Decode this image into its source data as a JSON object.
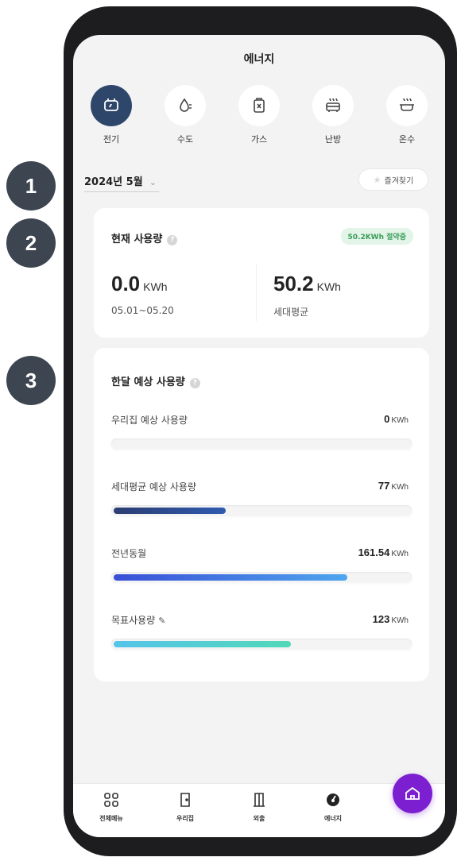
{
  "header": {
    "title": "에너지"
  },
  "categories": [
    {
      "label": "전기",
      "icon": "plug-icon",
      "active": true
    },
    {
      "label": "수도",
      "icon": "water-drop-icon",
      "active": false
    },
    {
      "label": "가스",
      "icon": "gas-can-icon",
      "active": false
    },
    {
      "label": "난방",
      "icon": "radiator-icon",
      "active": false
    },
    {
      "label": "온수",
      "icon": "hot-water-icon",
      "active": false
    }
  ],
  "markers": [
    "1",
    "2",
    "3"
  ],
  "period": {
    "month": "2024년 5월",
    "favorite_label": "즐겨찾기"
  },
  "current": {
    "title": "현재 사용량",
    "badge": "50.2KWh 절약중",
    "mine": {
      "value": "0.0",
      "unit": "KWh",
      "range": "05.01~05.20"
    },
    "average": {
      "value": "50.2",
      "unit": "KWh",
      "label": "세대평균"
    }
  },
  "forecast": {
    "title": "한달 예상 사용량",
    "rows": [
      {
        "label": "우리집 예상 사용량",
        "value": "0",
        "unit": "KWh",
        "fill_fraction": 0.0
      },
      {
        "label": "세대평균 예상 사용량",
        "value": "77",
        "unit": "KWh",
        "fill_fraction": 0.38
      },
      {
        "label": "전년동월",
        "value": "161.54",
        "unit": "KWh",
        "fill_fraction": 0.79
      },
      {
        "label": "목표사용량",
        "value": "123",
        "unit": "KWh",
        "fill_fraction": 0.6
      }
    ]
  },
  "tabbar": [
    {
      "label": "전체메뉴",
      "icon": "grid-icon"
    },
    {
      "label": "우리집",
      "icon": "door-icon"
    },
    {
      "label": "외출",
      "icon": "exit-door-icon"
    },
    {
      "label": "에너지",
      "icon": "gauge-icon"
    }
  ],
  "colors": {
    "active_category": "#2f466b",
    "badge_bg": "#e3f5e8",
    "badge_text": "#3b9c59",
    "fab": "#7b1fd0"
  }
}
